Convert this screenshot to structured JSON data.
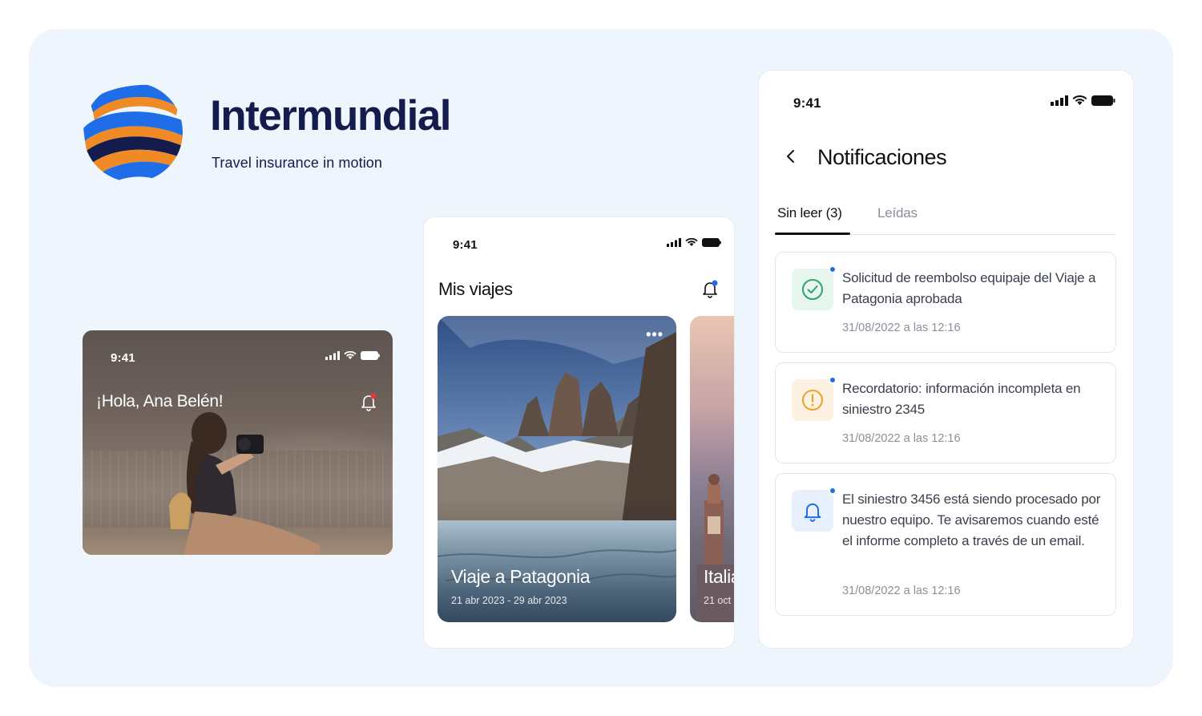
{
  "brand": {
    "name": "Intermundial",
    "tagline": "Travel insurance in motion",
    "colors": {
      "navy": "#141b4d",
      "blue": "#1f6ee8",
      "orange": "#f08a24"
    }
  },
  "home_card": {
    "time": "9:41",
    "greeting": "¡Hola, Ana Belén!",
    "icons": [
      "signal-icon",
      "wifi-icon",
      "battery-icon",
      "bell-icon"
    ]
  },
  "trips_screen": {
    "time": "9:41",
    "title": "Mis viajes",
    "trips": [
      {
        "name": "Viaje a Patagonia",
        "dates": "21 abr 2023 - 29 abr 2023",
        "more": "•••"
      },
      {
        "name": "Italia",
        "dates": "21 oct"
      }
    ]
  },
  "notifications_screen": {
    "time": "9:41",
    "title": "Notificaciones",
    "tabs": [
      {
        "label": "Sin leer (3)",
        "active": true
      },
      {
        "label": "Leídas",
        "active": false
      }
    ],
    "items": [
      {
        "icon": "check-circle-icon",
        "status_color": "#2fa36b",
        "text": "Solicitud de reembolso equipaje del Viaje a Patagonia aprobada",
        "date": "31/08/2022 a las 12:16"
      },
      {
        "icon": "alert-circle-icon",
        "status_color": "#f0a02a",
        "text": "Recordatorio: información incompleta en siniestro 2345",
        "date": "31/08/2022 a las 12:16"
      },
      {
        "icon": "bell-icon",
        "status_color": "#1f6ee8",
        "text": "El siniestro 3456 está siendo procesado por nuestro equipo. Te avisaremos cuando esté el informe completo a través de un email.",
        "date": "31/08/2022 a las 12:16"
      }
    ]
  }
}
